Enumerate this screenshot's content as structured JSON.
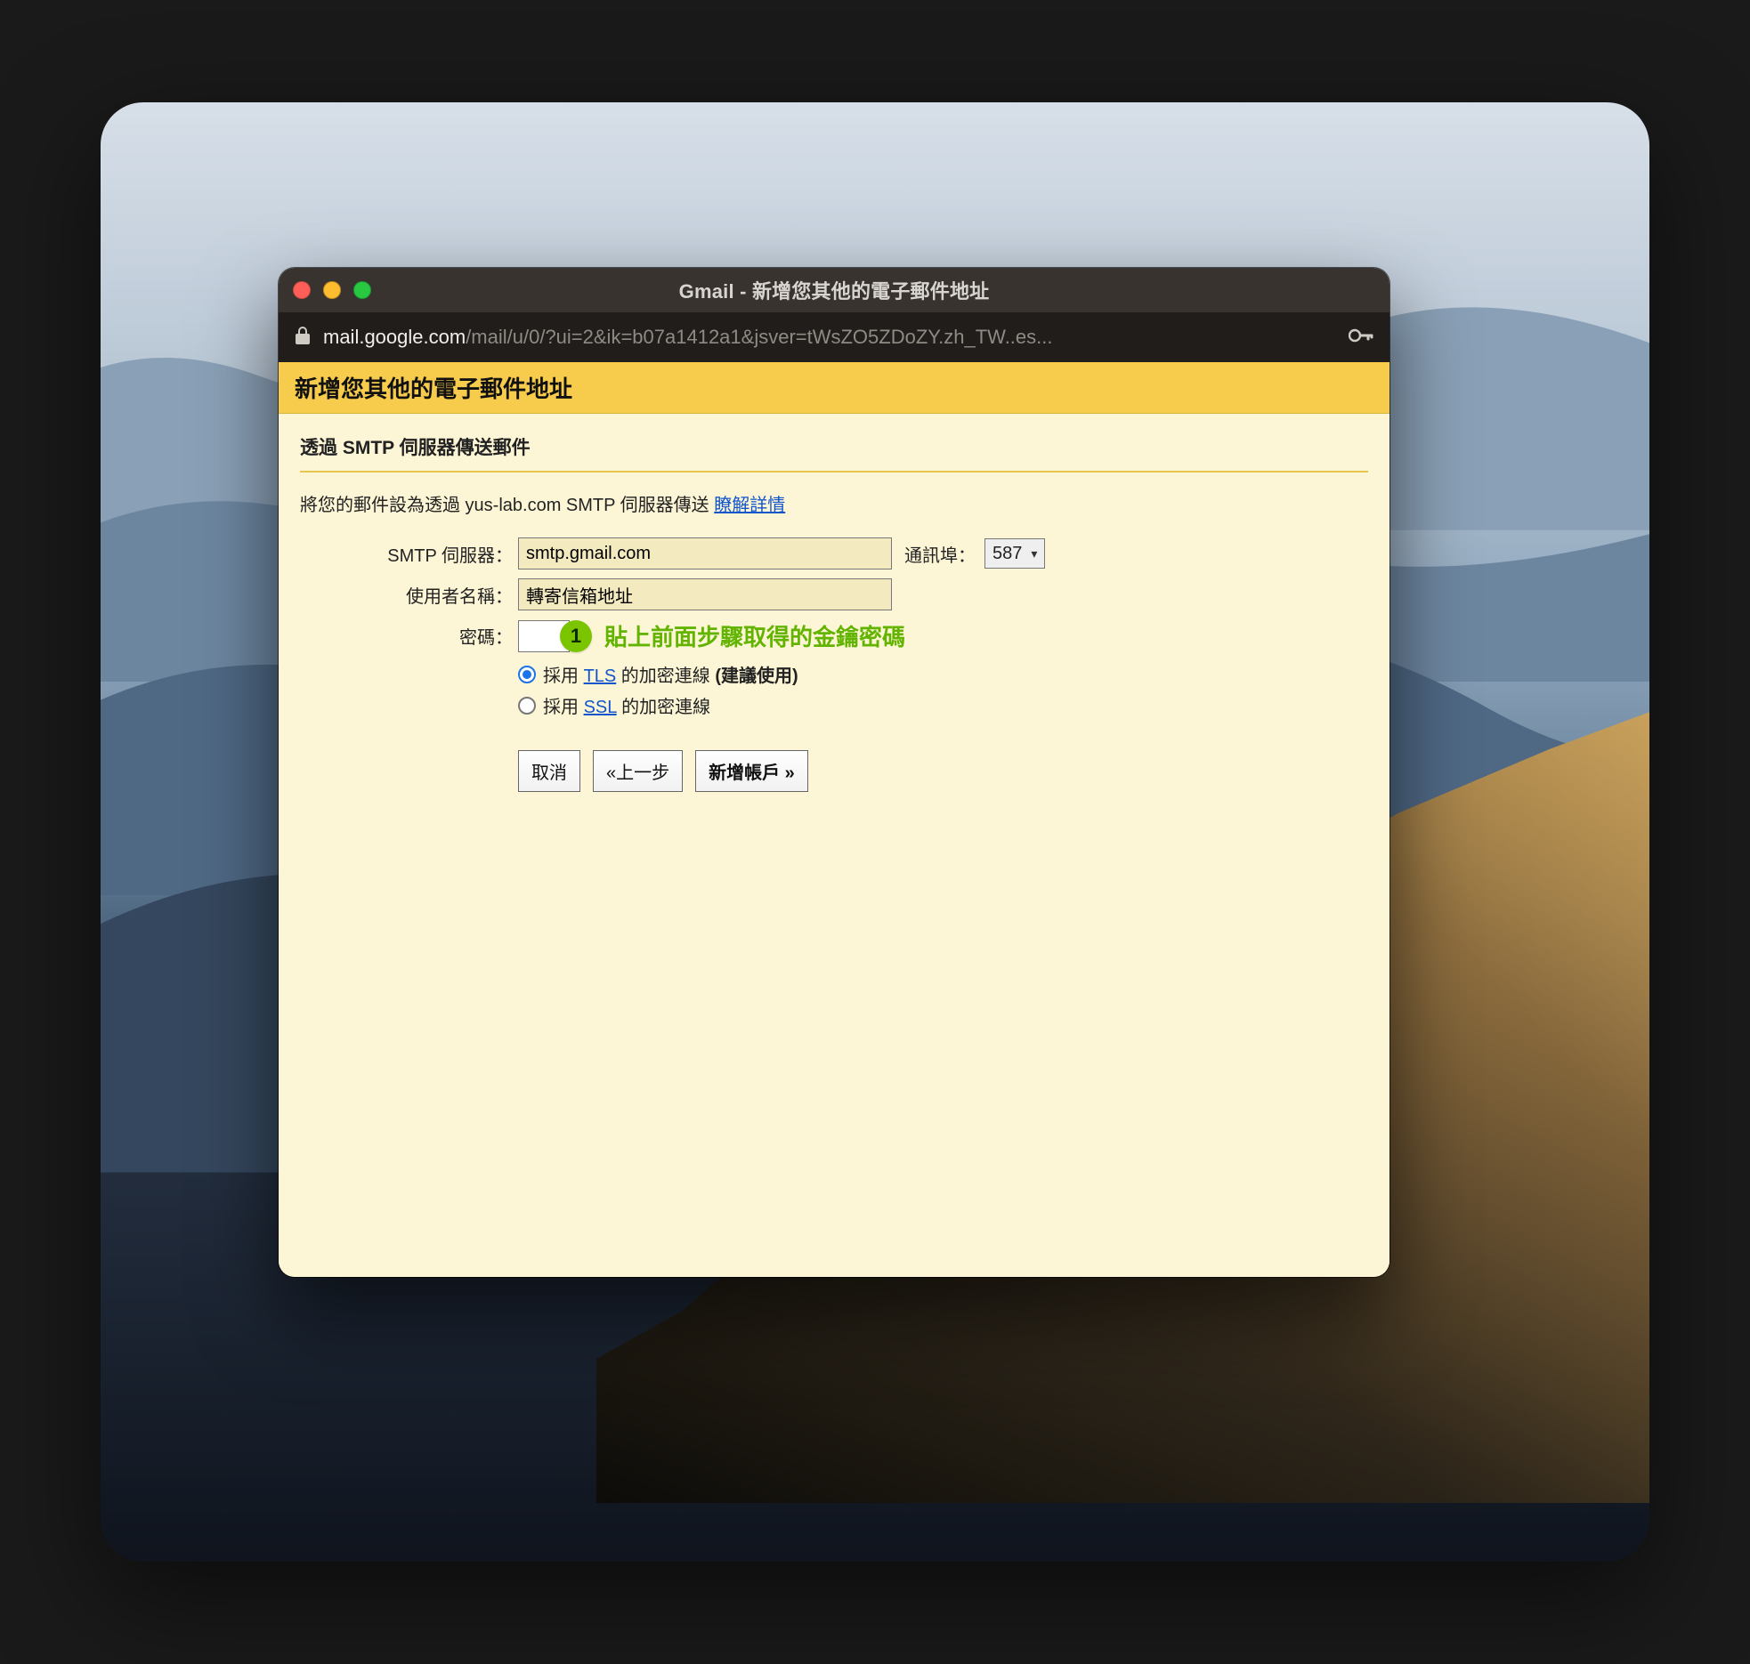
{
  "window": {
    "title": "Gmail - 新增您其他的電子郵件地址",
    "url_host": "mail.google.com",
    "url_path": "/mail/u/0/?ui=2&ik=b07a1412a1&jsver=tWsZO5ZDoZY.zh_TW..es..."
  },
  "page": {
    "header": "新增您其他的電子郵件地址",
    "section_title": "透過 SMTP 伺服器傳送郵件",
    "intro_prefix": "將您的郵件設為透過 yus-lab.com SMTP 伺服器傳送 ",
    "intro_link": "瞭解詳情"
  },
  "form": {
    "smtp_label": "SMTP 伺服器：",
    "smtp_value": "smtp.gmail.com",
    "port_label": "通訊埠：",
    "port_value": "587",
    "user_label": "使用者名稱：",
    "user_value": "轉寄信箱地址",
    "pwd_label": "密碼：",
    "pwd_value": "",
    "radio_tls_prefix": "採用 ",
    "radio_tls_link": "TLS",
    "radio_tls_suffix": " 的加密連線 ",
    "radio_tls_reco": "(建議使用)",
    "radio_ssl_prefix": "採用 ",
    "radio_ssl_link": "SSL",
    "radio_ssl_suffix": " 的加密連線"
  },
  "annotation": {
    "badge": "1",
    "text": "貼上前面步驟取得的金鑰密碼"
  },
  "buttons": {
    "cancel": "取消",
    "back": "«上一步",
    "add": "新增帳戶 »"
  }
}
